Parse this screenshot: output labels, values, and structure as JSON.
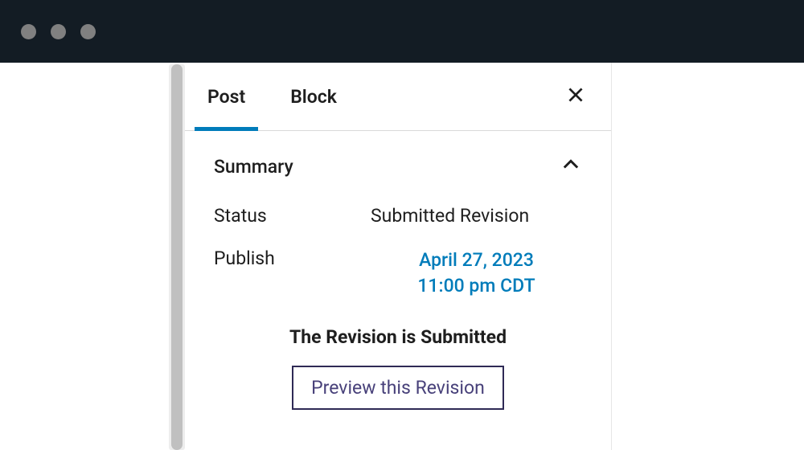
{
  "tabs": {
    "post": "Post",
    "block": "Block"
  },
  "section": {
    "summary": "Summary"
  },
  "fields": {
    "status_label": "Status",
    "status_value": "Submitted Revision",
    "publish_label": "Publish",
    "publish_date": "April 27, 2023",
    "publish_time": "11:00 pm CDT"
  },
  "revision": {
    "status_text": "The Revision is Submitted",
    "preview_label": "Preview this Revision"
  }
}
